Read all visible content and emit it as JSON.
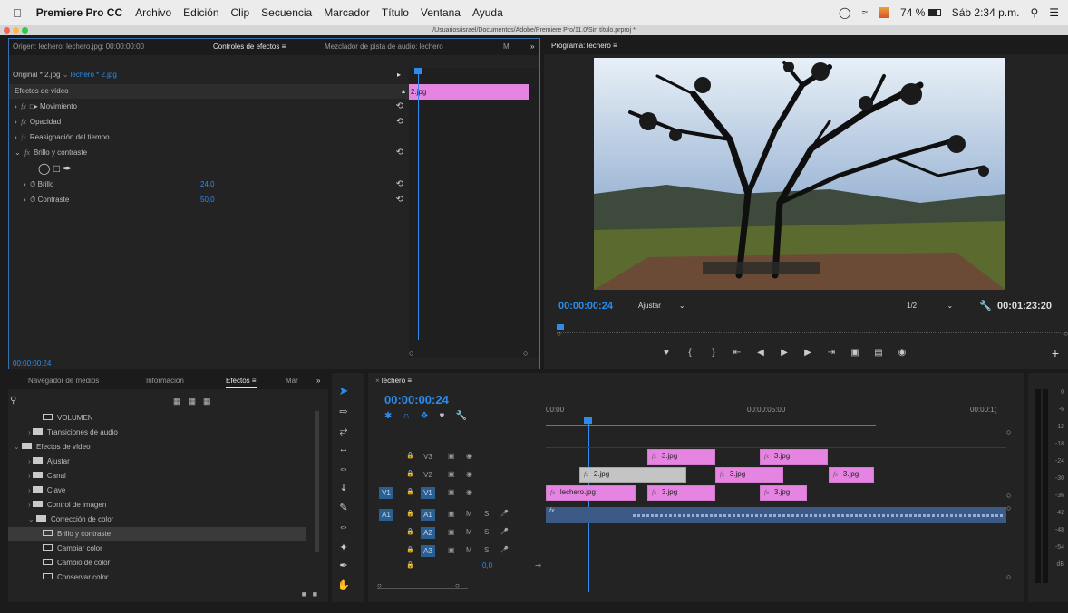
{
  "menubar": {
    "apple": "",
    "app": "Premiere Pro CC",
    "items": [
      "Archivo",
      "Edición",
      "Clip",
      "Secuencia",
      "Marcador",
      "Título",
      "Ventana",
      "Ayuda"
    ],
    "battery": "74 %",
    "clock": "Sáb 2:34 p.m."
  },
  "window": {
    "path": "/Usuarios/israel/Documentos/Adobe/Premiere Pro/11.0/Sin título.prproj *"
  },
  "source_panel": {
    "tabs": [
      "Origen: lechero: lechero.jpg: 00:00:00:00",
      "Controles de efectos",
      "Mezclador de pista de audio: lechero",
      "Mi"
    ],
    "breadcrumb_master": "Original * 2.jpg",
    "breadcrumb_seq": "lechero * 2.jpg",
    "section": "Efectos de vídeo",
    "clip_label": "2.jpg",
    "effects": [
      {
        "label": "Movimiento"
      },
      {
        "label": "Opacidad"
      },
      {
        "label": "Reasignación del tiempo"
      },
      {
        "label": "Brillo y contraste"
      }
    ],
    "params": [
      {
        "label": "Brillo",
        "value": "24,0"
      },
      {
        "label": "Contraste",
        "value": "50,0"
      }
    ],
    "timecode": "00:00:00:24"
  },
  "program_panel": {
    "title": "Programa: lechero",
    "timecode": "00:00:00:24",
    "fit": "Ajustar",
    "resolution": "1/2",
    "duration": "00:01:23:20"
  },
  "effects_panel": {
    "tabs": [
      "Navegador de medios",
      "Información",
      "Efectos",
      "Mar"
    ],
    "tree": [
      {
        "label": "Volumen",
        "indent": 2,
        "kind": "fx"
      },
      {
        "label": "Transiciones de audio",
        "indent": 1,
        "kind": "folder"
      },
      {
        "label": "Efectos de vídeo",
        "indent": 0,
        "kind": "folder"
      },
      {
        "label": "Ajustar",
        "indent": 1,
        "kind": "folder"
      },
      {
        "label": "Canal",
        "indent": 1,
        "kind": "folder"
      },
      {
        "label": "Clave",
        "indent": 1,
        "kind": "folder"
      },
      {
        "label": "Control de imagen",
        "indent": 1,
        "kind": "folder"
      },
      {
        "label": "Corrección de color",
        "indent": 1,
        "kind": "folder"
      },
      {
        "label": "Brillo y contraste",
        "indent": 2,
        "kind": "fx",
        "selected": true
      },
      {
        "label": "Cambiar color",
        "indent": 2,
        "kind": "fx"
      },
      {
        "label": "Cambio de color",
        "indent": 2,
        "kind": "fx"
      },
      {
        "label": "Conservar color",
        "indent": 2,
        "kind": "fx"
      }
    ]
  },
  "timeline": {
    "tab": "lechero",
    "timecode": "00:00:00:24",
    "ruler": [
      "00:00",
      "00:00:05:00",
      "00:00:1("
    ],
    "video_tracks": [
      "V3",
      "V2",
      "V1"
    ],
    "audio_tracks": [
      "A1",
      "A2",
      "A3"
    ],
    "source_v": "V1",
    "source_a": "A1",
    "audio_letters": [
      "M",
      "S"
    ],
    "master_value": "0,0",
    "clips": {
      "v3": [
        "3.jpg",
        "3.jpg"
      ],
      "v2": [
        "2.jpg",
        "3.jpg",
        "3.jpg"
      ],
      "v1": [
        "lechero.jpg",
        "3.jpg",
        "3.jpg"
      ]
    }
  },
  "meter": {
    "labels": [
      "0",
      "-6",
      "-12",
      "-18",
      "-24",
      "-30",
      "-36",
      "-42",
      "-48",
      "-54",
      "dB"
    ]
  }
}
